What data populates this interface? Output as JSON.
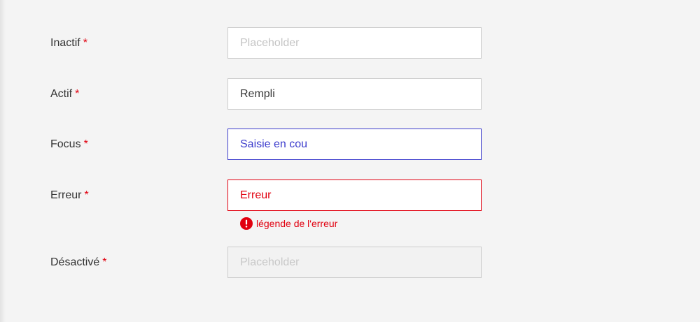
{
  "colors": {
    "required": "#e1000f",
    "focus": "#3b3bcc",
    "error": "#e1000f",
    "border": "#cccccc",
    "background": "#f4f4f4"
  },
  "fields": [
    {
      "label": "Inactif",
      "required_mark": "*",
      "value": "",
      "placeholder": "Placeholder",
      "state": "inactive"
    },
    {
      "label": "Actif",
      "required_mark": "*",
      "value": "Rempli",
      "placeholder": "",
      "state": "active"
    },
    {
      "label": "Focus",
      "required_mark": "*",
      "value": "Saisie en cou",
      "placeholder": "",
      "state": "focus"
    },
    {
      "label": "Erreur",
      "required_mark": "*",
      "value": "Erreur",
      "placeholder": "",
      "state": "error",
      "error_caption": "légende de l'erreur",
      "error_icon": "exclamation-circle-icon"
    },
    {
      "label": "Désactivé",
      "required_mark": "*",
      "value": "",
      "placeholder": "Placeholder",
      "state": "disabled"
    }
  ]
}
